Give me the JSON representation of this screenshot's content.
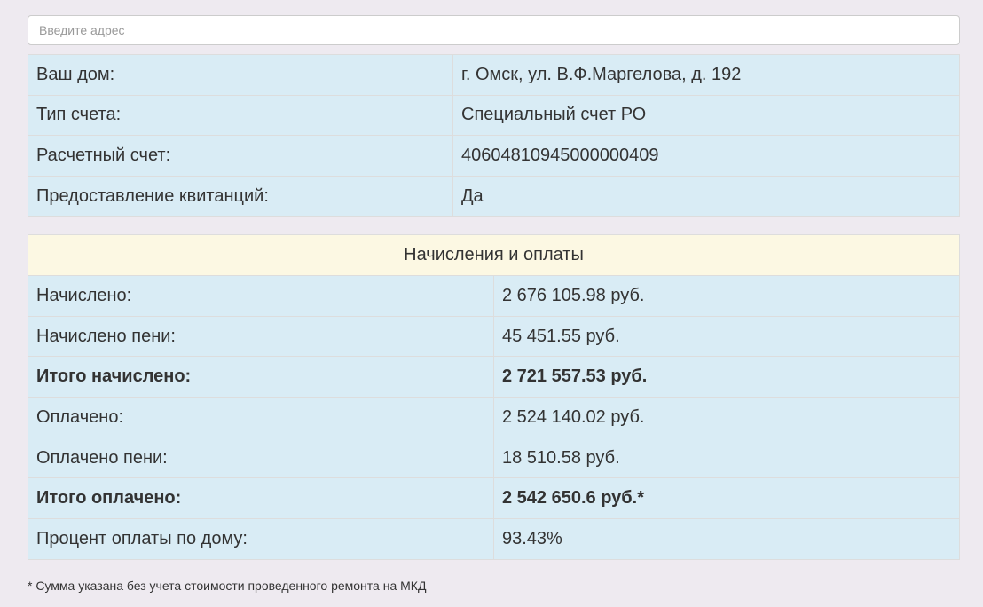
{
  "search": {
    "placeholder": "Введите адрес"
  },
  "house_info": {
    "rows": [
      {
        "label": "Ваш дом:",
        "value": "г. Омск, ул. В.Ф.Маргелова, д. 192"
      },
      {
        "label": "Тип счета:",
        "value": "Специальный счет РО"
      },
      {
        "label": "Расчетный счет:",
        "value": "40604810945000000409"
      },
      {
        "label": "Предоставление квитанций:",
        "value": "Да"
      }
    ]
  },
  "payments": {
    "header": "Начисления и оплаты",
    "rows": [
      {
        "label": "Начислено:",
        "value": "2 676 105.98 руб."
      },
      {
        "label": "Начислено пени:",
        "value": "45 451.55 руб."
      },
      {
        "label": "Итого начислено:",
        "value": "2 721 557.53 руб."
      },
      {
        "label": "Оплачено:",
        "value": "2 524 140.02 руб."
      },
      {
        "label": "Оплачено пени:",
        "value": "18 510.58 руб."
      },
      {
        "label": "Итого оплачено:",
        "value": "2 542 650.6 руб.*"
      },
      {
        "label": "Процент оплаты по дому:",
        "value": "93.43%"
      }
    ]
  },
  "footnote": "* Сумма указана без учета стоимости проведенного ремонта на МКД",
  "colors": {
    "page_background": "#eeeaf0",
    "table_row_background": "#d9ecf5",
    "header_background": "#fcf8e3",
    "border": "#dddddd"
  }
}
